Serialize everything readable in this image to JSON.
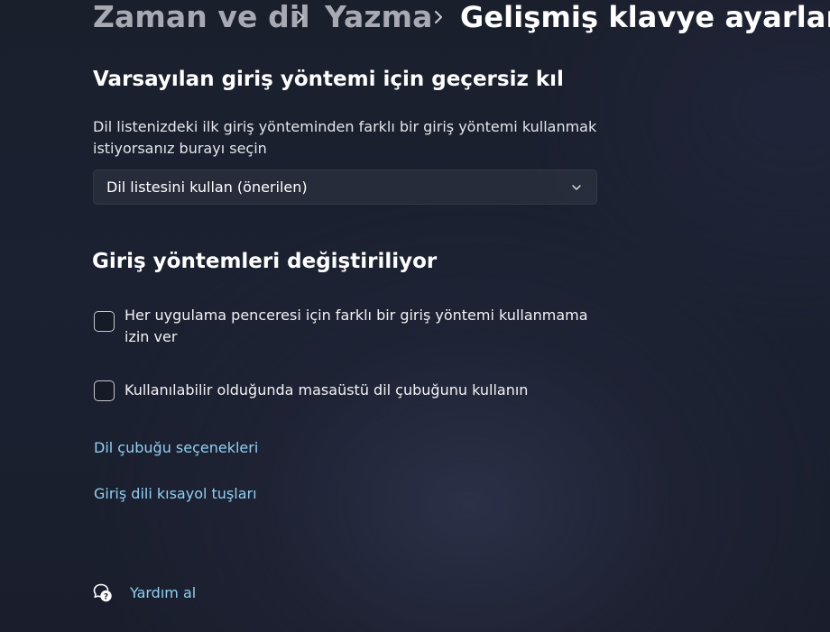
{
  "breadcrumb": {
    "items": [
      "Zaman ve dil",
      "Yazma"
    ],
    "current": "Gelişmiş klavye ayarları",
    "separator_icon": "chevron-right-icon"
  },
  "override": {
    "title": "Varsayılan giriş yöntemi için geçersiz kıl",
    "description": "Dil listenizdeki ilk giriş yönteminden farklı bir giriş yöntemi kullanmak istiyorsanız burayı seçin",
    "dropdown": {
      "selected": "Dil listesini kullan (önerilen)",
      "icon": "chevron-down-icon"
    }
  },
  "switching": {
    "title": "Giriş yöntemleri değiştiriliyor",
    "checkboxes": [
      {
        "label": "Her uygulama penceresi için farklı bir giriş yöntemi kullanmama izin ver",
        "checked": false
      },
      {
        "label": "Kullanılabilir olduğunda masaüstü dil çubuğunu kullanın",
        "checked": false
      }
    ]
  },
  "links": {
    "language_bar_options": "Dil çubuğu seçenekleri",
    "input_language_hotkeys": "Giriş dili kısayol tuşları"
  },
  "help": {
    "label": "Yardım al",
    "icon": "help-chat-icon"
  },
  "colors": {
    "link": "#8fd0f2",
    "background": "#1b2131",
    "muted_text": "#a7aab2"
  }
}
